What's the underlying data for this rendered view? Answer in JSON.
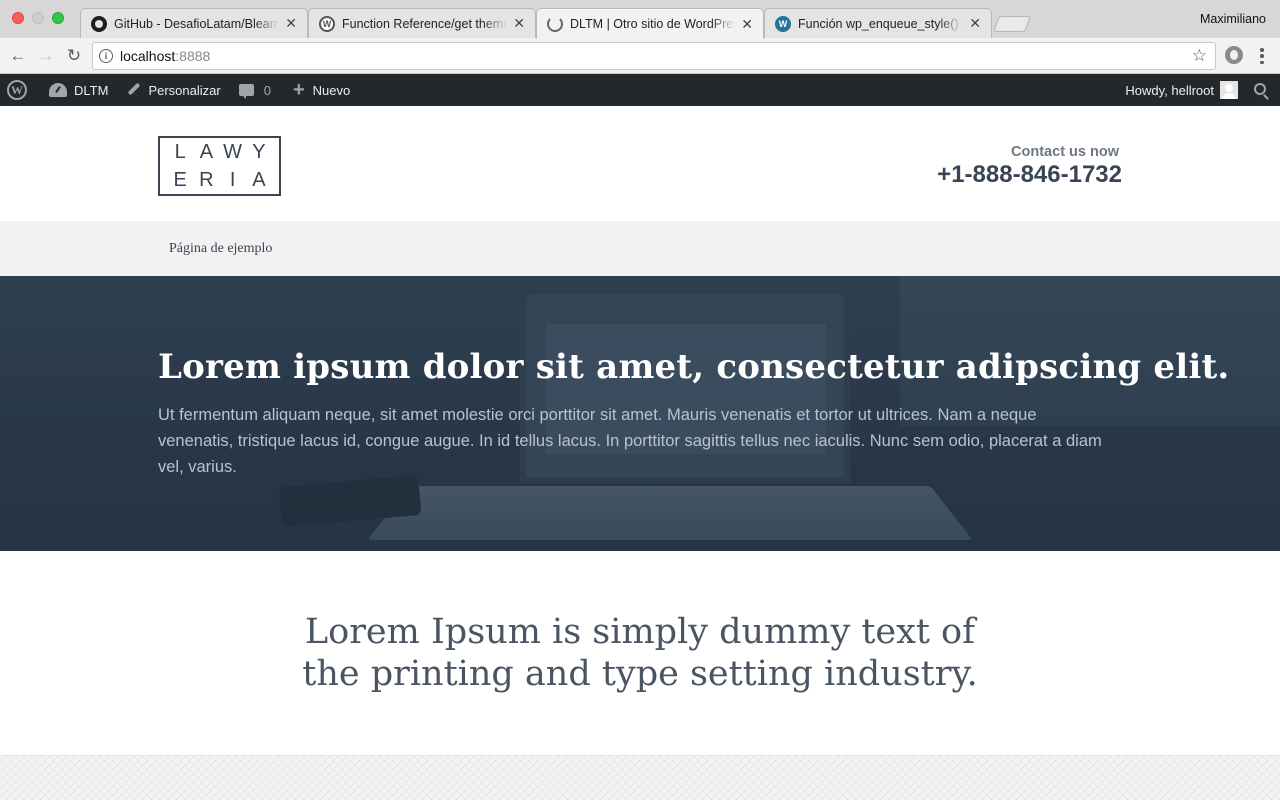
{
  "browser": {
    "profile_name": "Maximiliano",
    "tabs": [
      {
        "title": "GitHub - DesafioLatam/Blearning",
        "icon": "github-icon"
      },
      {
        "title": "Function Reference/get theme",
        "icon": "wordpress-icon"
      },
      {
        "title": "DLTM | Otro sitio de WordPress",
        "icon": "loading-icon",
        "active": true
      },
      {
        "title": "Función wp_enqueue_style() -",
        "icon": "wordpress-icon"
      }
    ],
    "address_host": "localhost",
    "address_port": ":8888"
  },
  "admin_bar": {
    "site_name": "DLTM",
    "customize_label": "Personalizar",
    "comments_count": "0",
    "new_label": "Nuevo",
    "howdy_text": "Howdy, hellroot"
  },
  "site": {
    "logo_letters": [
      "L",
      "A",
      "W",
      "Y",
      "E",
      "R",
      "I",
      "A"
    ],
    "contact_label": "Contact us now",
    "contact_phone": "+1-888-846-1732",
    "nav_items": [
      "Página de ejemplo"
    ]
  },
  "hero": {
    "title": "Lorem ipsum dolor sit amet, consectetur adipscing elit.",
    "text": "Ut fermentum aliquam neque, sit amet molestie orci porttitor sit amet. Mauris venenatis et tortor ut ultrices. Nam a neque venenatis, tristique lacus id, congue augue. In id tellus lacus. In porttitor sagittis tellus nec iaculis. Nunc sem odio, placerat a diam vel, varius."
  },
  "intro": {
    "text": "Lorem Ipsum is simply dummy text of the printing and type setting industry."
  },
  "colors": {
    "admin_bar_bg": "#23282d",
    "brand_dark": "#3b4454",
    "hero_overlay": "#2c3b4b",
    "nav_bg": "#f2f2f2"
  }
}
